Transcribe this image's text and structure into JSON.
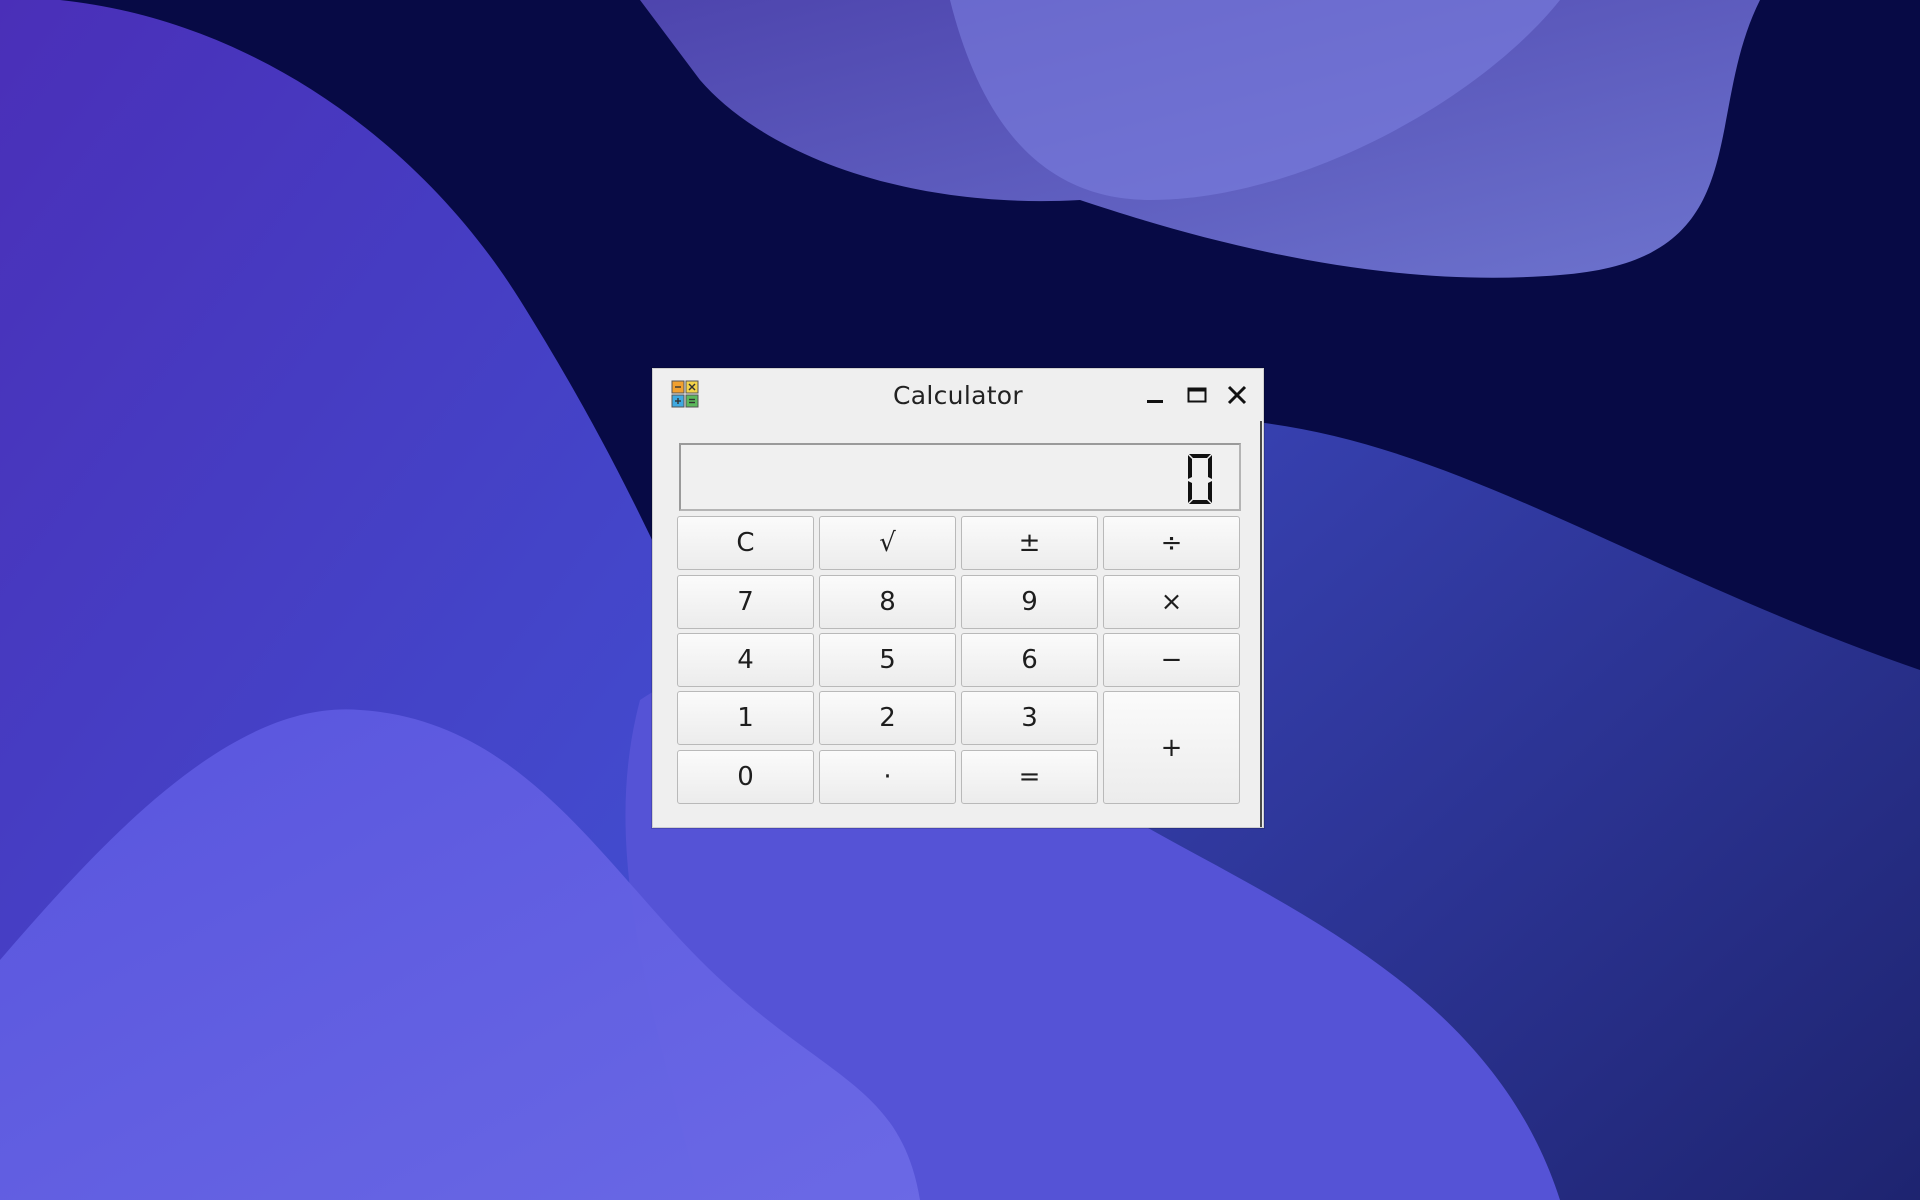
{
  "window": {
    "title": "Calculator",
    "controls": {
      "minimize": "minimize-icon",
      "maximize": "maximize-icon",
      "close": "close-icon"
    }
  },
  "display": {
    "value": "0"
  },
  "keys": {
    "clear": "C",
    "sqrt": "√",
    "negate": "±",
    "divide": "÷",
    "seven": "7",
    "eight": "8",
    "nine": "9",
    "multiply": "×",
    "four": "4",
    "five": "5",
    "six": "6",
    "subtract": "−",
    "one": "1",
    "two": "2",
    "three": "3",
    "add": "+",
    "zero": "0",
    "decimal": "·",
    "equals": "="
  },
  "colors": {
    "desktop_base": "#070a45",
    "window_bg": "#efefef",
    "icon_orange": "#f0a030",
    "icon_yellow": "#f2d34a",
    "icon_blue": "#3fa9e0",
    "icon_green": "#5cb85c"
  }
}
